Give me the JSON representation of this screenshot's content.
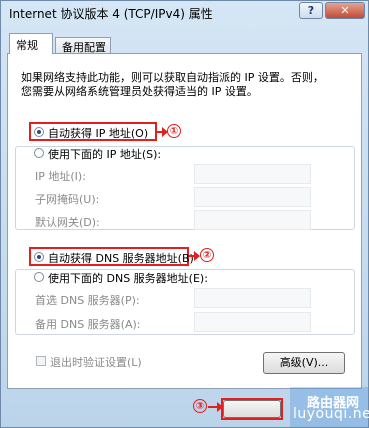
{
  "window": {
    "title": "Internet 协议版本 4 (TCP/IPv4) 属性",
    "help_label": "?",
    "close_label": "✕"
  },
  "tabs": [
    {
      "label": "常规"
    },
    {
      "label": "备用配置"
    }
  ],
  "description": {
    "line1": "如果网络支持此功能，则可以获取自动指派的 IP 设置。否则，",
    "line2": "您需要从网络系统管理员处获得适当的 IP 设置。"
  },
  "ip_section": {
    "auto_label": "自动获得 IP 地址(O)",
    "manual_label": "使用下面的 IP 地址(S):",
    "auto_selected": true,
    "fields": [
      {
        "label": "IP 地址(I):",
        "value": ""
      },
      {
        "label": "子网掩码(U):",
        "value": ""
      },
      {
        "label": "默认网关(D):",
        "value": ""
      }
    ]
  },
  "dns_section": {
    "auto_label": "自动获得 DNS 服务器地址(B)",
    "manual_label": "使用下面的 DNS 服务器地址(E):",
    "auto_selected": true,
    "fields": [
      {
        "label": "首选 DNS 服务器(P):",
        "value": ""
      },
      {
        "label": "备用 DNS 服务器(A):",
        "value": ""
      }
    ]
  },
  "validate_label": "退出时验证设置(L)",
  "advanced_label": "高级(V)...",
  "annotations": {
    "one": "①",
    "two": "②",
    "three": "③",
    "color": "#e31e1e"
  },
  "watermark": {
    "line1": "路由器网",
    "line2": "luyouqi.net"
  }
}
